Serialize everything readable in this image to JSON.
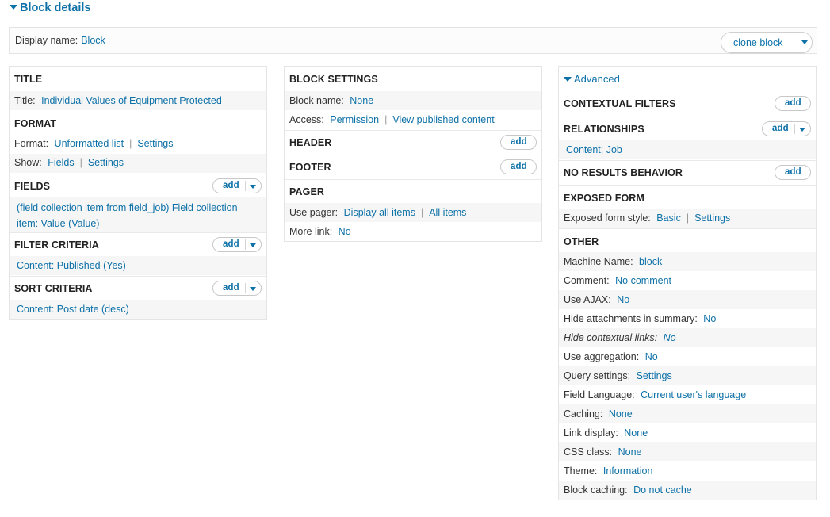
{
  "header": {
    "title": "Block details"
  },
  "display": {
    "label": "Display name:",
    "value": "Block",
    "clone_label": "clone block"
  },
  "col1": {
    "title": {
      "header": "TITLE",
      "label": "Title:",
      "value": "Individual Values of Equipment Protected"
    },
    "format": {
      "header": "FORMAT",
      "format_label": "Format:",
      "format_value": "Unformatted list",
      "format_settings": "Settings",
      "show_label": "Show:",
      "show_value": "Fields",
      "show_settings": "Settings"
    },
    "fields": {
      "header": "FIELDS",
      "add": "add",
      "item_line1": "(field collection item from field_job) Field collection",
      "item_line2": "item: Value (Value)"
    },
    "filter": {
      "header": "FILTER CRITERIA",
      "add": "add",
      "item": "Content: Published (Yes)"
    },
    "sort": {
      "header": "SORT CRITERIA",
      "add": "add",
      "item": "Content: Post date (desc)"
    }
  },
  "col2": {
    "block_settings": {
      "header": "BLOCK SETTINGS",
      "name_label": "Block name:",
      "name_value": "None",
      "access_label": "Access:",
      "access_value": "Permission",
      "access_detail": "View published content"
    },
    "header_sec": {
      "header": "HEADER",
      "add": "add"
    },
    "footer_sec": {
      "header": "FOOTER",
      "add": "add"
    },
    "pager": {
      "header": "PAGER",
      "use_label": "Use pager:",
      "use_value": "Display all items",
      "use_detail": "All items",
      "more_label": "More link:",
      "more_value": "No"
    }
  },
  "col3": {
    "advanced": "Advanced",
    "contextual": {
      "header": "CONTEXTUAL FILTERS",
      "add": "add"
    },
    "relationships": {
      "header": "RELATIONSHIPS",
      "add": "add",
      "item": "Content: Job"
    },
    "no_results": {
      "header": "NO RESULTS BEHAVIOR",
      "add": "add"
    },
    "exposed": {
      "header": "EXPOSED FORM",
      "label": "Exposed form style:",
      "value": "Basic",
      "settings": "Settings"
    },
    "other": {
      "header": "OTHER",
      "items": [
        {
          "label": "Machine Name:",
          "value": "block"
        },
        {
          "label": "Comment:",
          "value": "No comment"
        },
        {
          "label": "Use AJAX:",
          "value": "No"
        },
        {
          "label": "Hide attachments in summary:",
          "value": "No"
        },
        {
          "label": "Hide contextual links:",
          "value": "No"
        },
        {
          "label": "Use aggregation:",
          "value": "No"
        },
        {
          "label": "Query settings:",
          "value": "Settings"
        },
        {
          "label": "Field Language:",
          "value": "Current user's language"
        },
        {
          "label": "Caching:",
          "value": "None"
        },
        {
          "label": "Link display:",
          "value": "None"
        },
        {
          "label": "CSS class:",
          "value": "None"
        },
        {
          "label": "Theme:",
          "value": "Information"
        },
        {
          "label": "Block caching:",
          "value": "Do not cache"
        }
      ]
    }
  },
  "colors": {
    "link": "#0d71a8",
    "shade": "#f6f6f6",
    "border": "#e4e4e4"
  }
}
